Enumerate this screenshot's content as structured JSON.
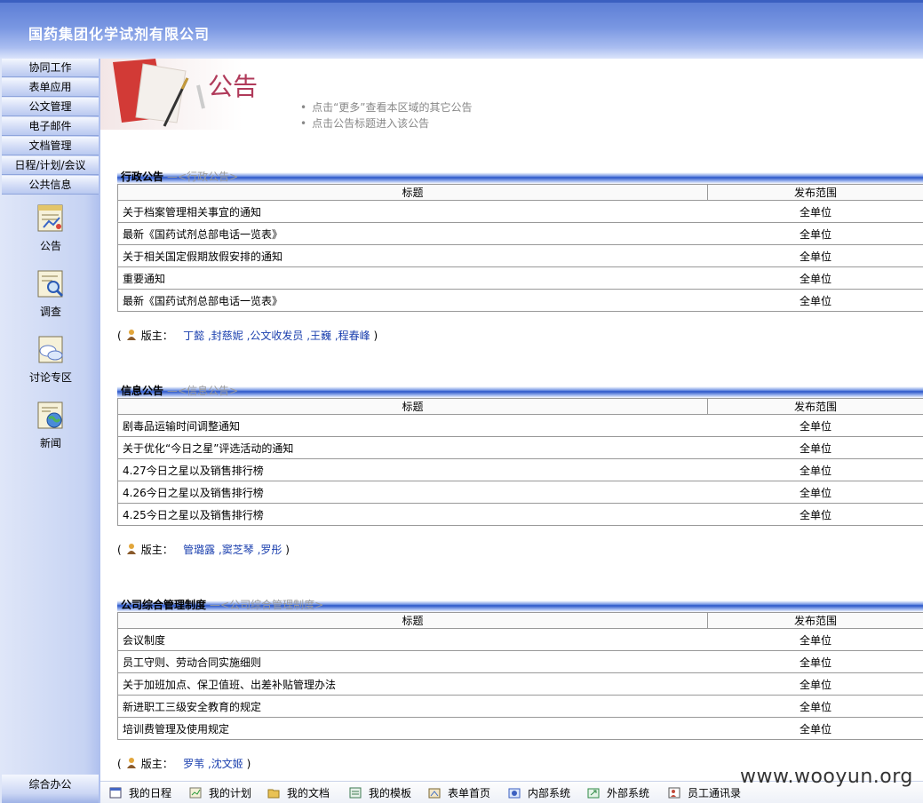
{
  "header": {
    "title": "国药集团化学试剂有限公司"
  },
  "sidebar": {
    "menu": [
      "协同工作",
      "表单应用",
      "公文管理",
      "电子邮件",
      "文档管理",
      "日程/计划/会议",
      "公共信息"
    ],
    "icons": [
      {
        "label": "公告",
        "icon": "bulletin-icon"
      },
      {
        "label": "调查",
        "icon": "survey-icon"
      },
      {
        "label": "讨论专区",
        "icon": "discussion-icon"
      },
      {
        "label": "新闻",
        "icon": "news-icon"
      }
    ],
    "bottom": "综合办公"
  },
  "banner": {
    "title": "公告",
    "hints": [
      "点击“更多”查看本区域的其它公告",
      "点击公告标题进入该公告"
    ]
  },
  "columns": {
    "title": "标题",
    "scope": "发布范围"
  },
  "sections": [
    {
      "title": "行政公告",
      "subtitle": "—<行政公告>",
      "rows": [
        {
          "title": "关于档案管理相关事宜的通知",
          "scope": "全单位"
        },
        {
          "title": "最新《国药试剂总部电话一览表》",
          "scope": "全单位"
        },
        {
          "title": "关于相关国定假期放假安排的通知",
          "scope": "全单位"
        },
        {
          "title": "重要通知",
          "scope": "全单位"
        },
        {
          "title": "最新《国药试剂总部电话一览表》",
          "scope": "全单位"
        }
      ],
      "moderator_label": "版主：",
      "moderators": "丁懿 ,封慈妮 ,公文收发员 ,王巍 ,程春峰"
    },
    {
      "title": "信息公告",
      "subtitle": "—<信息公告>",
      "rows": [
        {
          "title": "剧毒品运输时间调整通知",
          "scope": "全单位"
        },
        {
          "title": "关于优化“今日之星”评选活动的通知",
          "scope": "全单位"
        },
        {
          "title": "4.27今日之星以及销售排行榜",
          "scope": "全单位"
        },
        {
          "title": "4.26今日之星以及销售排行榜",
          "scope": "全单位"
        },
        {
          "title": "4.25今日之星以及销售排行榜",
          "scope": "全单位"
        }
      ],
      "moderator_label": "版主：",
      "moderators": "管璐露 ,窦芝琴 ,罗彤"
    },
    {
      "title": "公司综合管理制度",
      "subtitle": "—<公司综合管理制度>",
      "rows": [
        {
          "title": "会议制度",
          "scope": "全单位"
        },
        {
          "title": "员工守则、劳动合同实施细则",
          "scope": "全单位"
        },
        {
          "title": "关于加班加点、保卫值班、出差补贴管理办法",
          "scope": "全单位"
        },
        {
          "title": "新进职工三级安全教育的规定",
          "scope": "全单位"
        },
        {
          "title": "培训费管理及使用规定",
          "scope": "全单位"
        }
      ],
      "moderator_label": "版主：",
      "moderators": "罗苇 ,沈文姬"
    }
  ],
  "toolbar": [
    "我的日程",
    "我的计划",
    "我的文档",
    "我的模板",
    "表单首页",
    "内部系统",
    "外部系统",
    "员工通讯录"
  ],
  "watermark": "www.wooyun.org"
}
